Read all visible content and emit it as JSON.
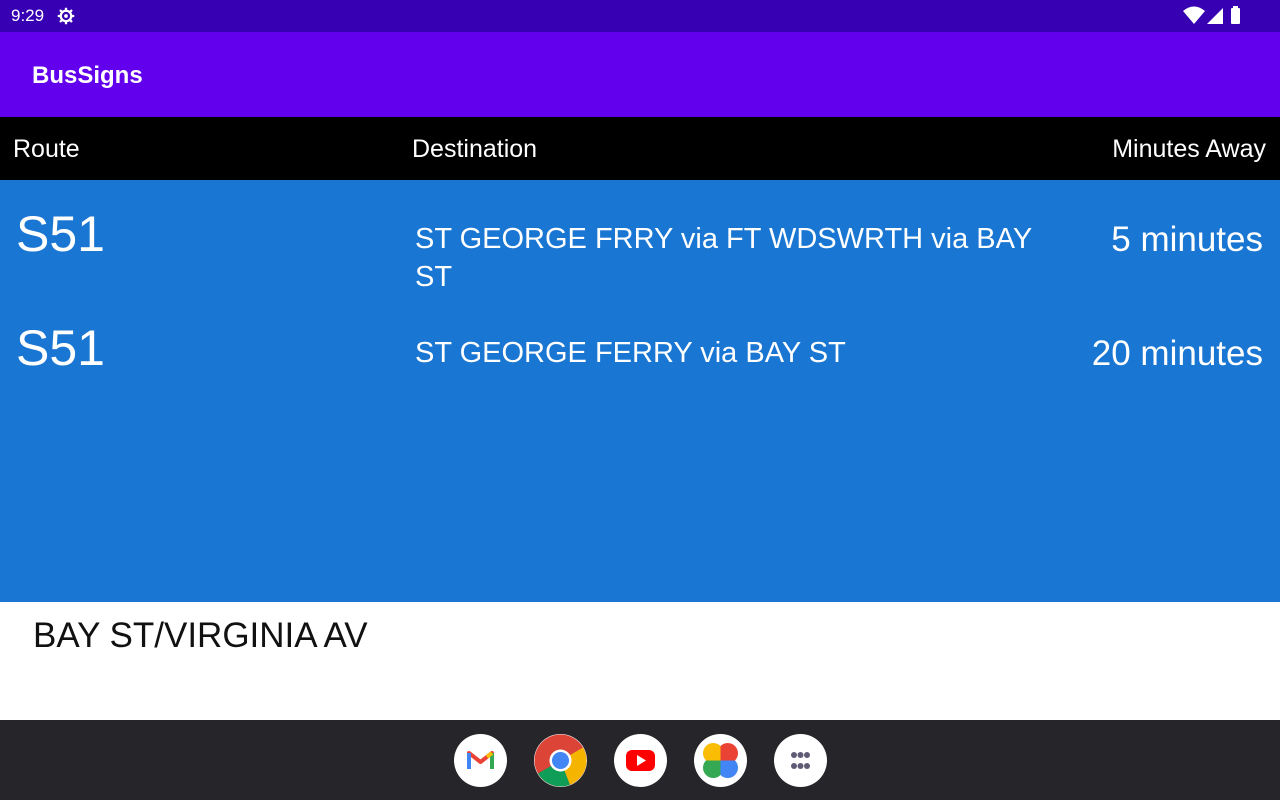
{
  "status_bar": {
    "time": "9:29",
    "icons": [
      "settings-gear-icon",
      "wifi-icon",
      "cell-signal-icon",
      "battery-icon"
    ]
  },
  "app": {
    "title": "BusSigns",
    "primary_color": "#6200ee",
    "status_color": "#3700b3",
    "list_color": "#1976d2"
  },
  "table": {
    "headers": {
      "route": "Route",
      "destination": "Destination",
      "minutes": "Minutes Away"
    },
    "rows": [
      {
        "route": "S51",
        "destination": "ST GEORGE FRRY via FT WDSWRTH via BAY ST",
        "minutes": "5 minutes"
      },
      {
        "route": "S51",
        "destination": "ST GEORGE FERRY via BAY ST",
        "minutes": "20 minutes"
      }
    ]
  },
  "stop": {
    "name": "BAY ST/VIRGINIA AV"
  },
  "dock": {
    "apps": [
      "gmail-icon",
      "chrome-icon",
      "youtube-icon",
      "photos-icon",
      "app-drawer-icon"
    ]
  }
}
